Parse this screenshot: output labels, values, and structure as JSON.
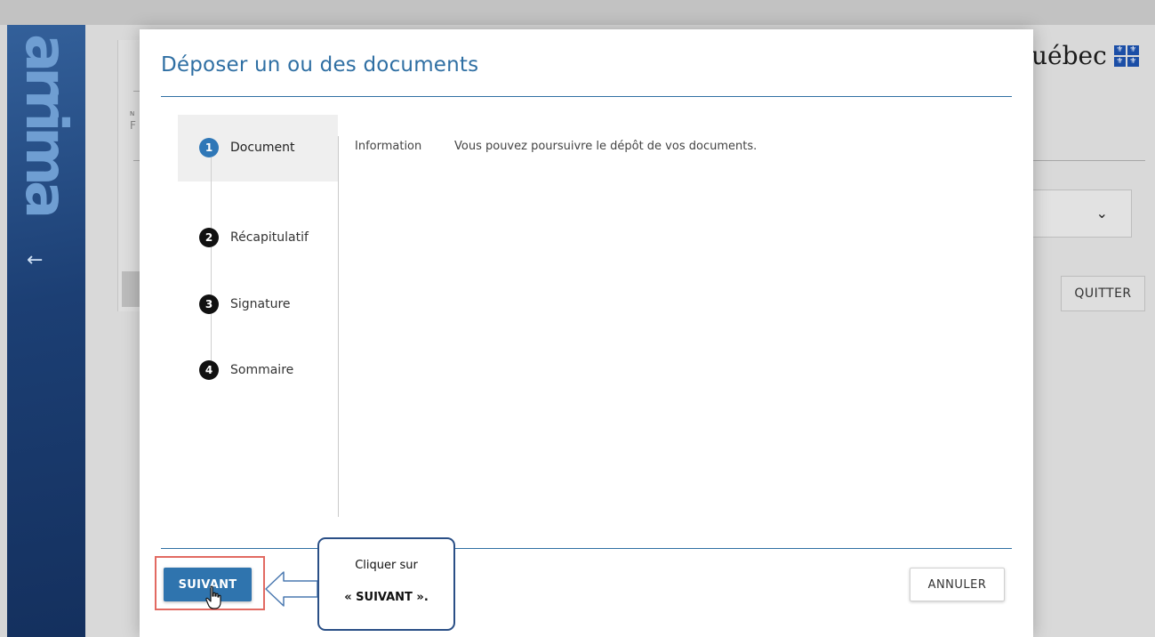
{
  "background": {
    "brand_logo_text": "arrima",
    "back_arrow": "←",
    "quebec_text": "uébec",
    "quebec_flag_glyph": "⚜",
    "partial_field_label": "N",
    "partial_field_value": "F",
    "select_chevron": "⌄",
    "quit_label": "QUITTER"
  },
  "modal": {
    "title": "Déposer un ou des documents",
    "steps": [
      {
        "number": "1",
        "label": "Document",
        "active": true
      },
      {
        "number": "2",
        "label": "Récapitulatif",
        "active": false
      },
      {
        "number": "3",
        "label": "Signature",
        "active": false
      },
      {
        "number": "4",
        "label": "Sommaire",
        "active": false
      }
    ],
    "info_label": "Information",
    "info_text": "Vous pouvez poursuivre le dépôt de vos documents.",
    "next_label": "SUIVANT",
    "cancel_label": "ANNULER"
  },
  "callout": {
    "line1": "Cliquer sur",
    "line2": "« SUIVANT »."
  },
  "colors": {
    "accent": "#2f74ae",
    "highlight": "#e26a62",
    "callout_border": "#2a4f86"
  }
}
